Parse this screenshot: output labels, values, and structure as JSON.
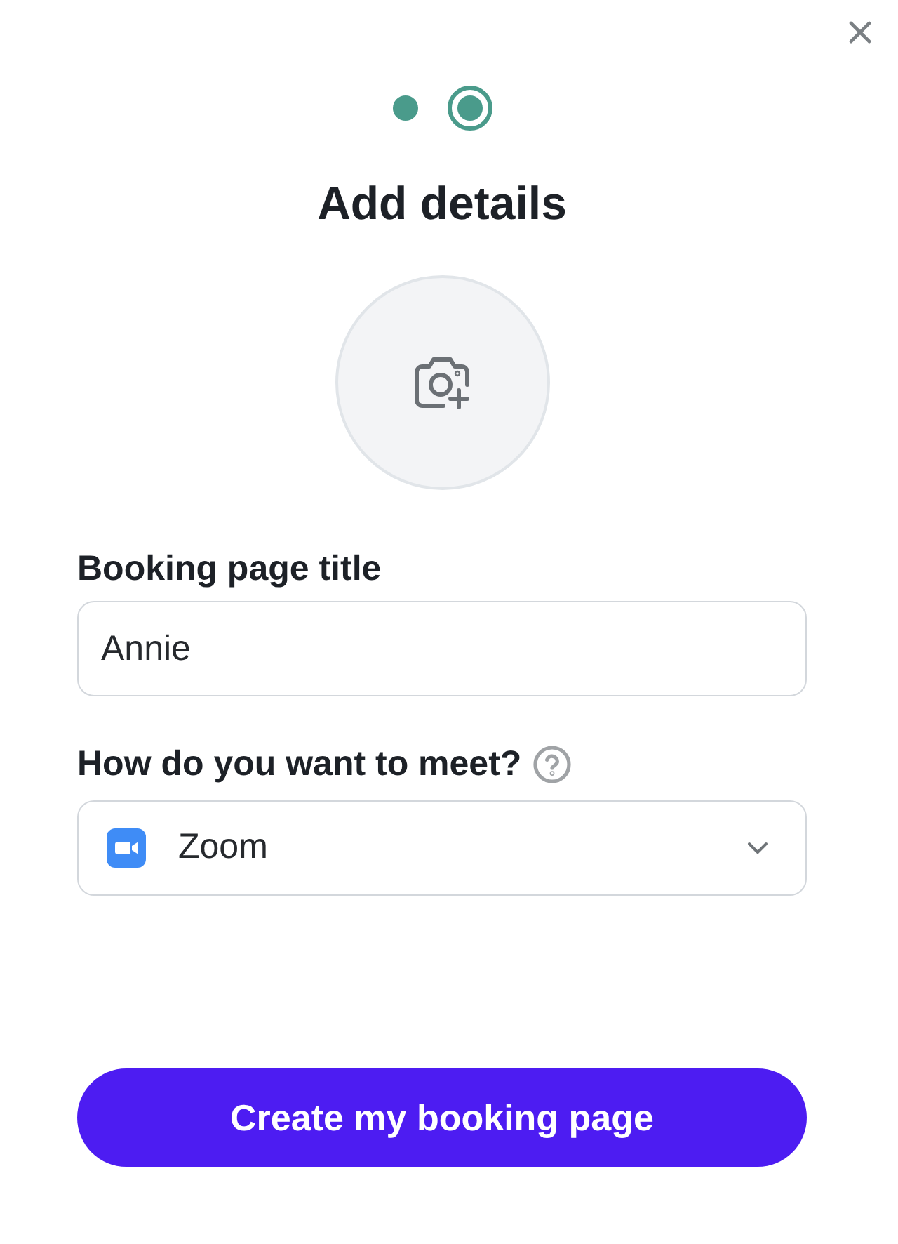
{
  "steps": [
    {
      "selected": false
    },
    {
      "selected": true
    }
  ],
  "title": "Add details",
  "fields": [
    {
      "kind": "text",
      "label": "Booking page title",
      "value": "Annie",
      "help_icon": false
    },
    {
      "kind": "select",
      "label": "How do you want to meet?",
      "value": "Zoom",
      "help_icon": true
    }
  ],
  "primary_button": {
    "label": "Create my booking page"
  }
}
